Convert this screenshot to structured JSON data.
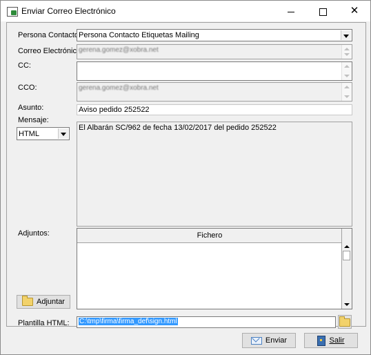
{
  "window": {
    "title": "Enviar Correo Electrónico",
    "controls": {
      "minimize": "minimize",
      "maximize": "maximize",
      "close": "✕"
    }
  },
  "form": {
    "persona_contacto": {
      "label": "Persona Contacto:",
      "value": "Persona Contacto Etiquetas Mailing"
    },
    "correo": {
      "label": "Correo Electrónico:",
      "value": "gerena.gomez@xobra.net"
    },
    "cc": {
      "label": "CC:",
      "value": ""
    },
    "cco": {
      "label": "CCO:",
      "value": "gerena.gomez@xobra.net"
    },
    "asunto": {
      "label": "Asunto:",
      "value": "Aviso pedido 252522"
    },
    "mensaje": {
      "label": "Mensaje:",
      "format_selected": "HTML",
      "body": "El Albarán SC/962 de fecha 13/02/2017 del pedido 252522"
    },
    "adjuntos": {
      "label": "Adjuntos:",
      "column_header": "Fichero",
      "rows": [],
      "attach_button": "Adjuntar"
    },
    "plantilla": {
      "label": "Plantilla HTML:",
      "value": "C:\\tmp\\firma\\firma_def\\sign.html"
    }
  },
  "buttons": {
    "enviar": "Enviar",
    "salir": "Salir"
  }
}
